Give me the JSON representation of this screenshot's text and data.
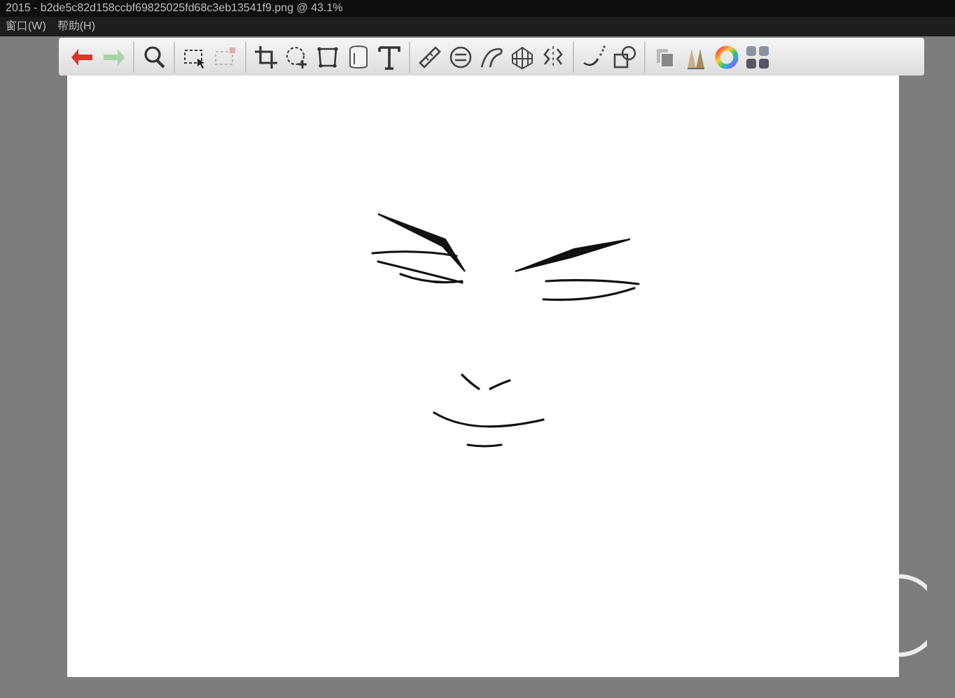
{
  "window": {
    "title": "2015 - b2de5c82d158ccbf69825025fd68c3eb13541f9.png @ 43.1%"
  },
  "menu": [
    {
      "label": "窗口(W)"
    },
    {
      "label": "帮助(H)"
    }
  ],
  "toolbar": {
    "groups": [
      [
        {
          "kind": "undo",
          "disabled": false
        },
        {
          "kind": "redo",
          "disabled": true
        }
      ],
      [
        {
          "kind": "zoom",
          "disabled": false
        }
      ],
      [
        {
          "kind": "select",
          "disabled": false
        },
        {
          "kind": "deselect",
          "disabled": true
        }
      ],
      [
        {
          "kind": "crop",
          "disabled": false
        },
        {
          "kind": "move",
          "disabled": false
        },
        {
          "kind": "distort",
          "disabled": false
        },
        {
          "kind": "fill",
          "disabled": false
        },
        {
          "kind": "text",
          "disabled": false
        }
      ],
      [
        {
          "kind": "ruler",
          "disabled": false
        },
        {
          "kind": "ellipse",
          "disabled": false
        },
        {
          "kind": "curve",
          "disabled": false
        },
        {
          "kind": "perspective",
          "disabled": false
        },
        {
          "kind": "symmetry",
          "disabled": false
        }
      ],
      [
        {
          "kind": "stroke",
          "disabled": false
        },
        {
          "kind": "shapes",
          "disabled": false
        }
      ],
      [
        {
          "kind": "layers",
          "disabled": false
        },
        {
          "kind": "brushes",
          "disabled": false
        },
        {
          "kind": "color",
          "disabled": false
        },
        {
          "kind": "grid",
          "disabled": false
        }
      ]
    ]
  }
}
